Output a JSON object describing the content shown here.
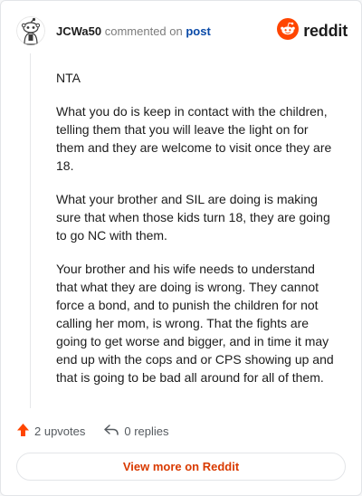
{
  "header": {
    "username": "JCWa50",
    "verb": "commented on",
    "post_link": "post",
    "brand": "reddit",
    "avatar_icon": "snoo-avatar-icon",
    "brand_icon": "reddit-logo-icon"
  },
  "comment": {
    "paragraphs": [
      "NTA",
      "What you do is keep in contact with the children, telling them that you will leave the light on for them and they are welcome to visit once they are 18.",
      "What your brother and SIL are doing is making sure that when those kids turn 18, they are going to go NC with them.",
      "Your brother and his wife needs to understand that what they are doing is wrong. They cannot force a bond, and to punish the children for not calling her mom, is wrong. That the fights are going to get worse and bigger, and in time it may end up with the cops and or CPS showing up and that is going to be bad all around for all of them."
    ]
  },
  "actions": {
    "upvotes": "2 upvotes",
    "replies": "0 replies",
    "upvote_icon": "upvote-arrow-icon",
    "reply_icon": "reply-arrow-icon"
  },
  "footer": {
    "view_more": "View more on Reddit"
  },
  "colors": {
    "brand_orange": "#ff4500",
    "link_blue": "#0a4aa8",
    "cta_text": "#d93a00"
  }
}
